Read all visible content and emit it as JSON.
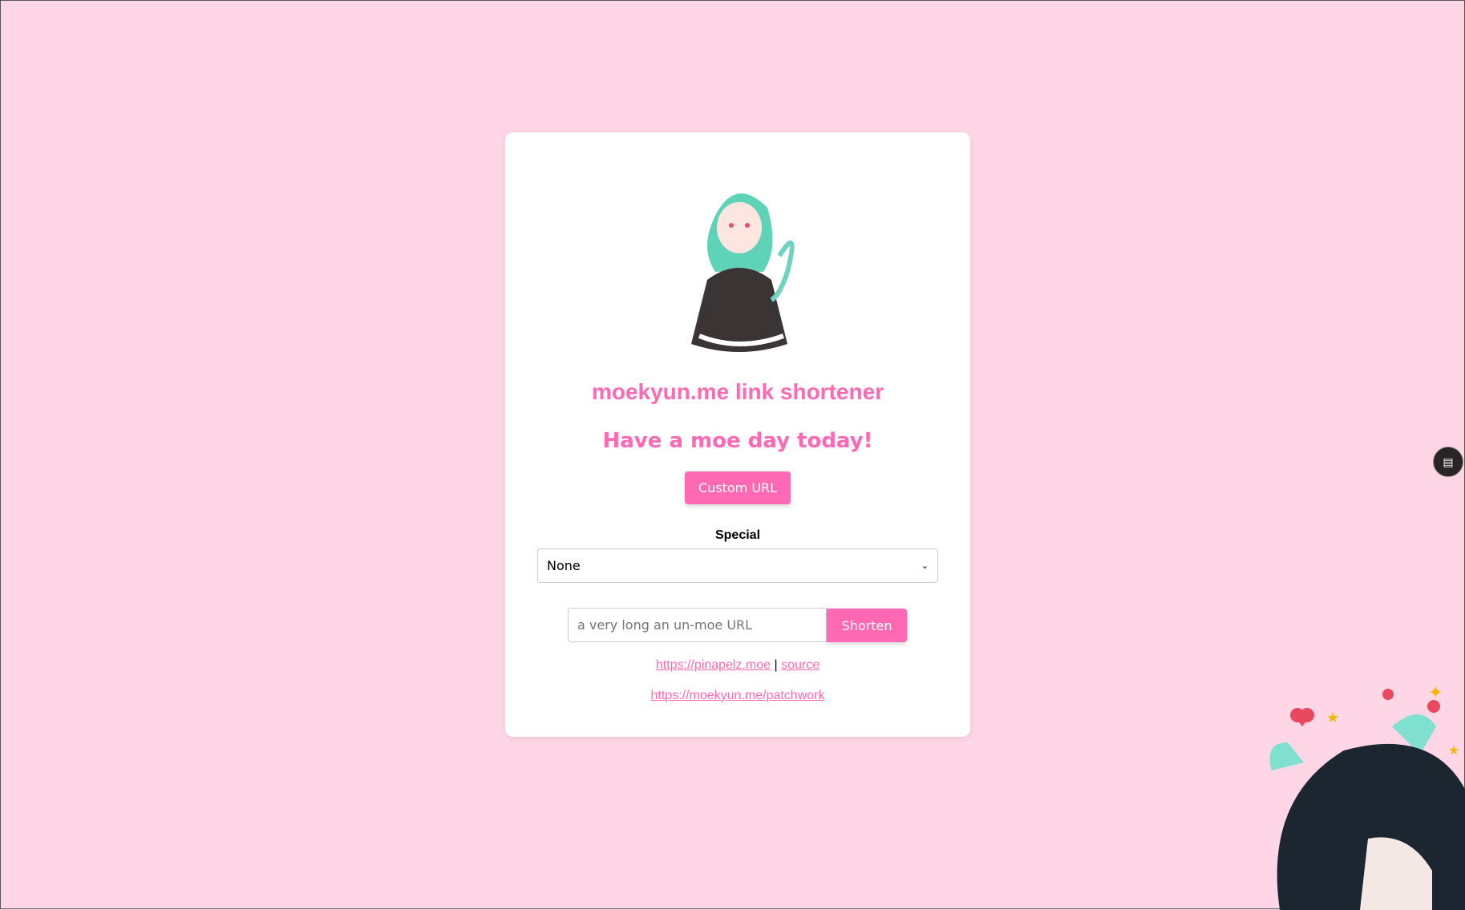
{
  "header": {
    "title": "moekyun.me link shortener",
    "subtitle": "Have a moe day today!"
  },
  "buttons": {
    "custom_url": "Custom URL",
    "shorten": "Shorten"
  },
  "special": {
    "label": "Special",
    "selected": "None"
  },
  "url_input": {
    "placeholder": "a very long an un-moe URL"
  },
  "footer": {
    "link1": "https://pinapelz.moe",
    "separator": "|",
    "link2": "source",
    "link3": "https://moekyun.me/patchwork"
  },
  "colors": {
    "accent": "#ff69b4",
    "background": "#ffd6e6"
  }
}
